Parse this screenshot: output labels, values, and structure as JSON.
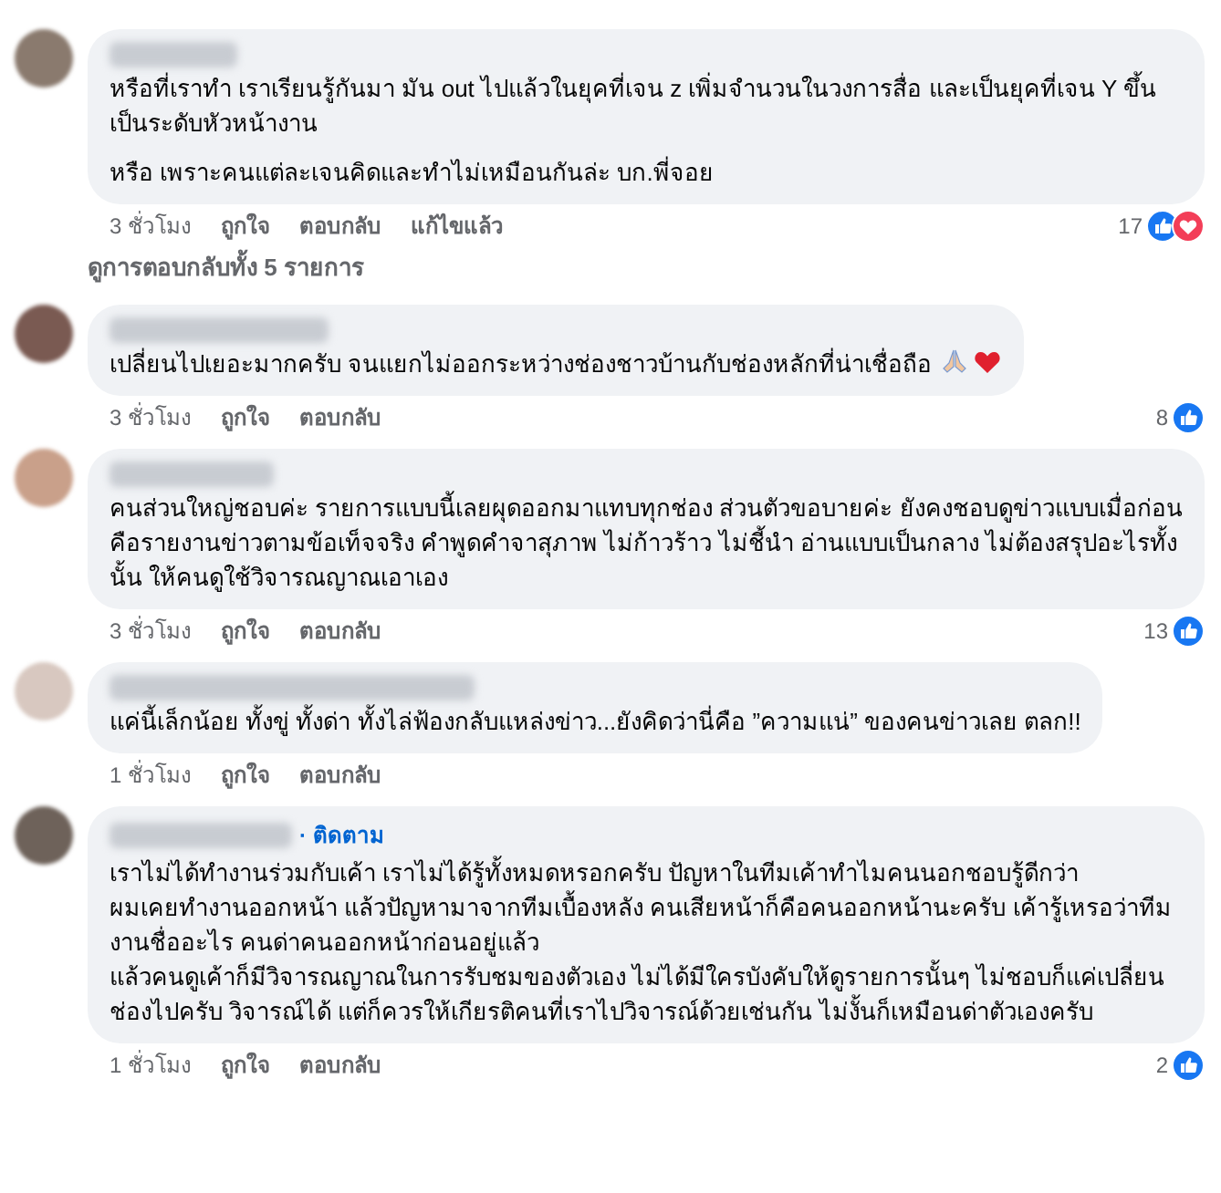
{
  "comments": [
    {
      "paragraphs": [
        "หรือที่เราทำ เราเรียนรู้กันมา มัน out ไปแล้วในยุคที่เจน z เพิ่มจำนวนในวงการสื่อ และเป็นยุคที่เจน Y ขึ้นเป็นระดับหัวหน้างาน",
        "หรือ เพราะคนแต่ละเจนคิดและทำไม่เหมือนกันล่ะ บก.พี่จอย"
      ],
      "time": "3 ชั่วโมง",
      "actions": [
        "ถูกใจ",
        "ตอบกลับ",
        "แก้ไขแล้ว"
      ],
      "reaction_count": "17",
      "reactions": [
        {
          "kind": "like"
        },
        {
          "kind": "love"
        }
      ],
      "view_replies": "ดูการตอบกลับทั้ง 5 รายการ"
    },
    {
      "paragraphs": [
        "เปลี่ยนไปเยอะมากครับ จนแยกไม่ออกระหว่างช่องชาวบ้านกับช่องหลักที่น่าเชื่อถือ"
      ],
      "trailing_icons": [
        {
          "kind": "pray"
        },
        {
          "kind": "heart"
        }
      ],
      "time": "3 ชั่วโมง",
      "actions": [
        "ถูกใจ",
        "ตอบกลับ"
      ],
      "reaction_count": "8",
      "reactions": [
        {
          "kind": "like"
        }
      ]
    },
    {
      "paragraphs": [
        "คนส่วนใหญ่ชอบค่ะ รายการแบบนี้เลยผุดออกมาแทบทุกช่อง ส่วนตัวขอบายค่ะ ยังคงชอบดูข่าวแบบเมื่อก่อน คือรายงานข่าวตามข้อเท็จจริง คำพูดคำจาสุภาพ ไม่ก้าวร้าว ไม่ชี้นำ อ่านแบบเป็นกลาง ไม่ต้องสรุปอะไรทั้งนั้น ให้คนดูใช้วิจารณญาณเอาเอง"
      ],
      "time": "3 ชั่วโมง",
      "actions": [
        "ถูกใจ",
        "ตอบกลับ"
      ],
      "reaction_count": "13",
      "reactions": [
        {
          "kind": "like"
        }
      ]
    },
    {
      "paragraphs": [
        "แค่นี้เล็กน้อย ทั้งขู่ ทั้งด่า ทั้งไล่ฟ้องกลับแหล่งข่าว...ยังคิดว่านี่คือ ”ความแน่” ของคนข่าวเลย ตลก!!"
      ],
      "time": "1 ชั่วโมง",
      "actions": [
        "ถูกใจ",
        "ตอบกลับ"
      ]
    },
    {
      "follow": "· ติดตาม",
      "paragraphs": [
        "เราไม่ได้ทำงานร่วมกับเค้า เราไม่ได้รู้ทั้งหมดหรอกครับ ปัญหาในทีมเค้าทำไมคนนอกชอบรู้ดีกว่า\nผมเคยทำงานออกหน้า แล้วปัญหามาจากทีมเบื้องหลัง คนเสียหน้าก็คือคนออกหน้านะครับ เค้ารู้เหรอว่าทีมงานชื่ออะไร คนด่าคนออกหน้าก่อนอยู่แล้ว\nแล้วคนดูเค้าก็มีวิจารณญาณในการรับชมของตัวเอง ไม่ได้มีใครบังคับให้ดูรายการนั้นๆ ไม่ชอบก็แค่เปลี่ยนช่องไปครับ วิจารณ์ได้ แต่ก็ควรให้เกียรติคนที่เราไปวิจารณ์ด้วยเช่นกัน ไม่งั้นก็เหมือนด่าตัวเองครับ"
      ],
      "time": "1 ชั่วโมง",
      "actions": [
        "ถูกใจ",
        "ตอบกลับ"
      ],
      "reaction_count": "2",
      "reactions": [
        {
          "kind": "like"
        }
      ]
    }
  ]
}
